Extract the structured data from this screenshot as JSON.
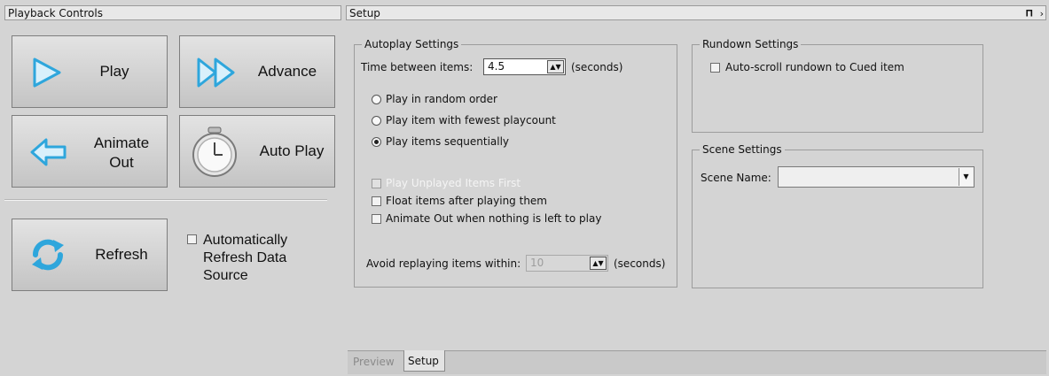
{
  "playback": {
    "title": "Playback Controls",
    "play_label": "Play",
    "advance_label": "Advance",
    "animate_out_label": [
      "Animate",
      "Out"
    ],
    "autoplay_label": "Auto Play",
    "refresh_label": "Refresh",
    "auto_refresh_label": [
      "Automatically",
      "Refresh Data",
      "Source"
    ]
  },
  "setup": {
    "title": "Setup",
    "pin_icon": "pin-icon",
    "autoplay": {
      "title": "Autoplay Settings",
      "time_between_label": "Time between items:",
      "time_between_value": "4.5",
      "seconds_unit": "(seconds)",
      "radio_random": "Play in random order",
      "radio_fewest": "Play item with fewest playcount",
      "radio_sequential": "Play items sequentially",
      "selected_radio": "sequential",
      "chk_unplayed_first": "Play Unplayed Items First",
      "chk_float_items": "Float items after playing them",
      "chk_animate_out": "Animate Out when nothing is left to play",
      "avoid_label": "Avoid replaying items within:",
      "avoid_value": "10",
      "avoid_unit": "(seconds)"
    },
    "rundown": {
      "title": "Rundown Settings",
      "auto_scroll_label": "Auto-scroll rundown to Cued item"
    },
    "scene": {
      "title": "Scene Settings",
      "scene_name_label": "Scene Name:",
      "scene_name_value": ""
    },
    "tabs": [
      "Preview",
      "Setup"
    ],
    "active_tab": "Setup"
  }
}
